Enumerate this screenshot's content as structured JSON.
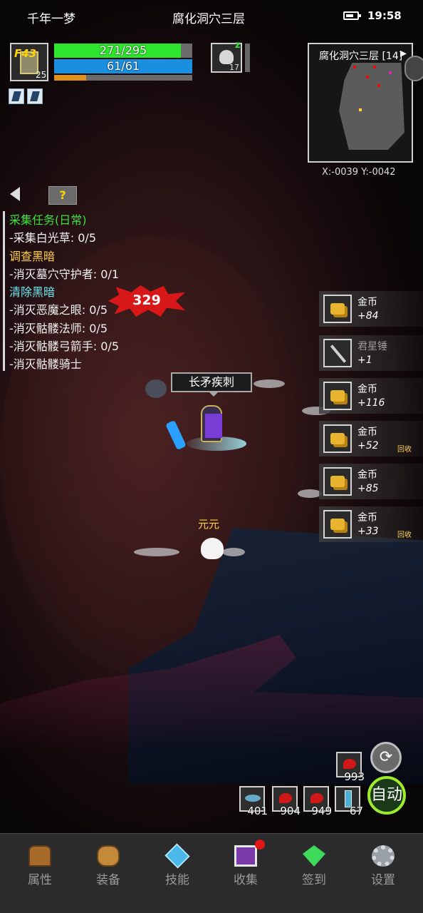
{
  "status_bar": {
    "left_title": "千年一梦",
    "location": "腐化洞穴三层",
    "time": "19:58"
  },
  "player": {
    "portrait_level_tag": "F43",
    "portrait_number": "25",
    "hp_text": "271/295",
    "hp_fraction": 0.92,
    "mp_text": "61/61",
    "mp_fraction": 1.0,
    "xp_fraction": 0.23
  },
  "pet_hud": {
    "number": "17",
    "status_icon": "sleep-zz-icon"
  },
  "minimap": {
    "title": "腐化洞穴三层 [14]",
    "coords": "X:-0039  Y:-0042"
  },
  "quest_panel": {
    "help_label": "?",
    "lines": [
      {
        "text": "采集任务(日常)",
        "style": "h-green"
      },
      {
        "text": "-采集白光草: 0/5",
        "style": "item"
      },
      {
        "text": "调查黑暗",
        "style": "h-yellow"
      },
      {
        "text": "-消灭墓穴守护者: 0/1",
        "style": "item"
      },
      {
        "text": "清除黑暗",
        "style": "h-cyan"
      },
      {
        "text": "-消灭恶魔之眼: 0/5",
        "style": "item"
      },
      {
        "text": "-消灭骷髅法师: 0/5",
        "style": "item"
      },
      {
        "text": "-消灭骷髅弓箭手: 0/5",
        "style": "item"
      },
      {
        "text": "-消灭骷髅骑士",
        "style": "item"
      }
    ]
  },
  "combat": {
    "damage_number": "329",
    "skill_name": "长矛疾刺",
    "pet_name": "元元"
  },
  "loot_feed": [
    {
      "name": "金币",
      "amount": "+84",
      "icon": "coin",
      "tag": ""
    },
    {
      "name": "君星锤",
      "amount": "+1",
      "icon": "wand",
      "tag": ""
    },
    {
      "name": "金币",
      "amount": "+116",
      "icon": "coin",
      "tag": ""
    },
    {
      "name": "金币",
      "amount": "+52",
      "icon": "coin",
      "tag": "回收"
    },
    {
      "name": "金币",
      "amount": "+85",
      "icon": "coin",
      "tag": ""
    },
    {
      "name": "金币",
      "amount": "+33",
      "icon": "coin",
      "tag": "回收"
    }
  ],
  "quick_slots": {
    "top": {
      "count": "993",
      "icon": "red-potion-icon"
    },
    "row": [
      {
        "count": "401",
        "icon": "fish-icon"
      },
      {
        "count": "904",
        "icon": "red-potion-icon"
      },
      {
        "count": "949",
        "icon": "red-potion-icon"
      },
      {
        "count": "67",
        "icon": "vial-icon"
      }
    ],
    "cycle_glyph": "⟳",
    "auto_label": "自动"
  },
  "nav": [
    {
      "label": "属性",
      "icon": "helmet-icon"
    },
    {
      "label": "装备",
      "icon": "bag-icon"
    },
    {
      "label": "技能",
      "icon": "skill-gem-icon"
    },
    {
      "label": "收集",
      "icon": "collection-icon"
    },
    {
      "label": "签到",
      "icon": "checkin-gem-icon"
    },
    {
      "label": "设置",
      "icon": "gear-icon"
    }
  ],
  "colors": {
    "hp": "#2ee52e",
    "mp": "#1a8fe0",
    "xp": "#e0901a",
    "auto_ring": "#9eea2c",
    "quest_green": "#3ee03e",
    "quest_yellow": "#ffd04a",
    "notification": "#e01818"
  }
}
